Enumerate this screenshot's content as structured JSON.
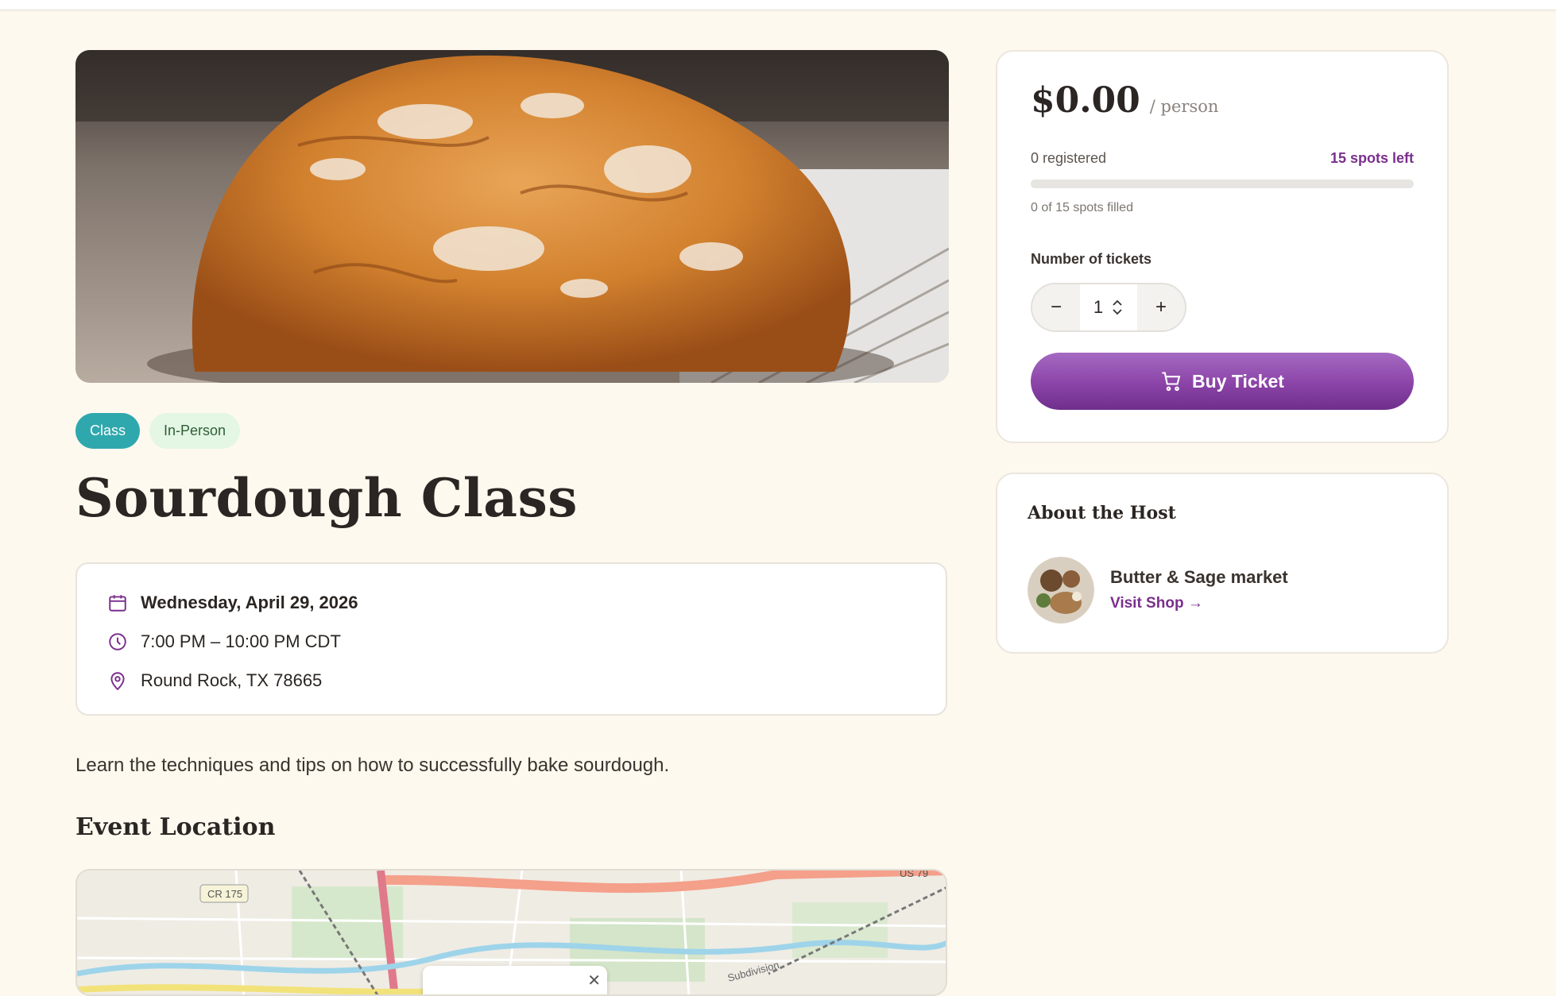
{
  "event": {
    "hero_alt": "Sourdough bread loaf",
    "tags": [
      "Class",
      "In-Person"
    ],
    "title": "Sourdough Class",
    "date": "Wednesday, April 29, 2026",
    "time": "7:00 PM – 10:00 PM CDT",
    "location": "Round Rock, TX 78665",
    "description": "Learn the techniques and tips on how to successfully bake sourdough.",
    "location_heading": "Event Location"
  },
  "map": {
    "labels": [
      "CR 175",
      "US 79",
      "Subdivision"
    ]
  },
  "ticket": {
    "price": "$0.00",
    "price_unit": "/ person",
    "registered": "0 registered",
    "spots_left": "15 spots left",
    "filled_text": "0 of 15 spots filled",
    "filled_fraction": 0,
    "tickets_label": "Number of tickets",
    "minus": "−",
    "plus": "+",
    "quantity": "1",
    "buy_label": "Buy Ticket"
  },
  "host": {
    "heading": "About the Host",
    "name": "Butter & Sage market",
    "visit_label": "Visit Shop →"
  },
  "colors": {
    "background": "#fdf9ee",
    "accent": "#7a2f8c",
    "tag_class": "#2fa8ad",
    "tag_inperson": "#e4f6e4"
  },
  "icons": [
    "calendar-icon",
    "clock-icon",
    "map-pin-icon",
    "cart-icon",
    "minus-icon",
    "plus-icon",
    "spinner-icon",
    "close-icon"
  ]
}
